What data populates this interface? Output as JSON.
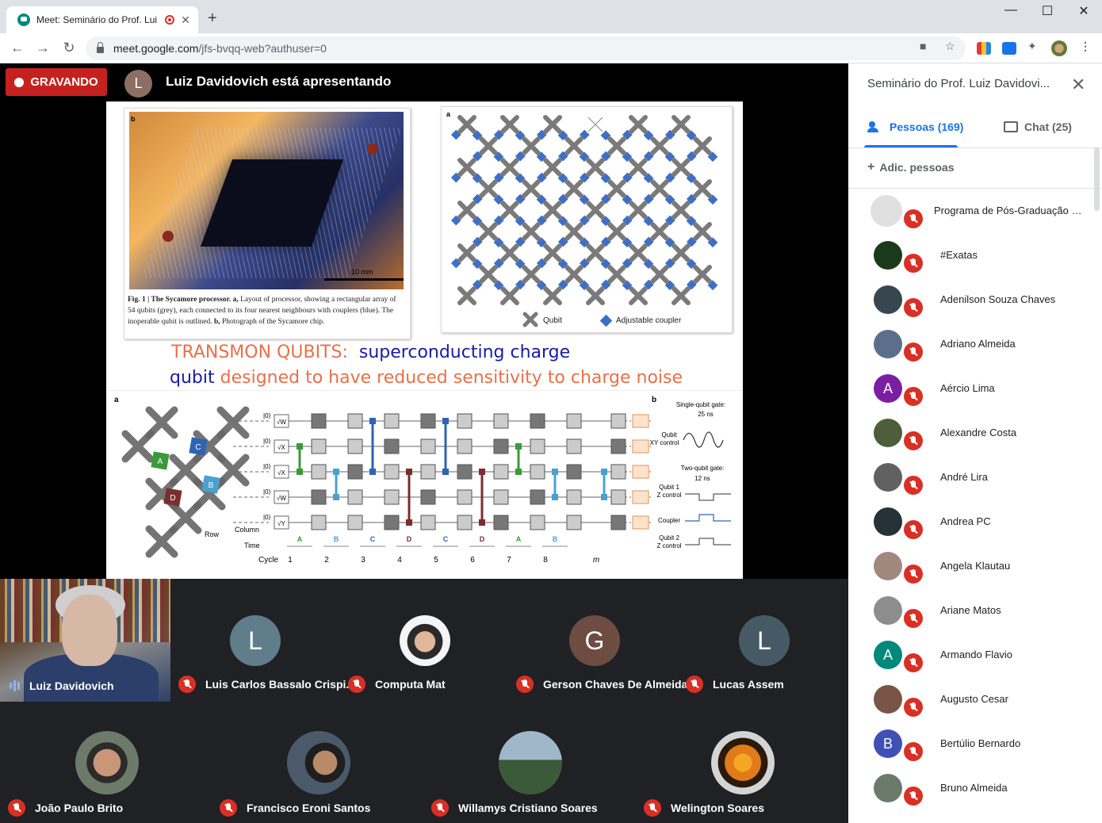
{
  "browser": {
    "tab_title": "Meet: Seminário do Prof. Lui",
    "tab_close": "✕",
    "new_tab": "+",
    "url_host": "meet.google.com",
    "url_path": "/jfs-bvqq-web?authuser=0",
    "window_min": "—",
    "window_max": "☐",
    "window_close": "✕"
  },
  "meet": {
    "recording_label": "GRAVANDO",
    "presenter_initial": "L",
    "presenter_text": "Luiz Davidovich está apresentando"
  },
  "slide": {
    "panel_b_label": "b",
    "scale_label": "10 mm",
    "caption_bold": "Fig. 1 | The Sycamore processor.",
    "caption_a": "a,",
    "caption_rest": " Layout of processor, showing a rectangular array of 54 qubits (grey), each connected to its four nearest neighbours with couplers (blue). The inoperable qubit is outlined.",
    "caption_b": "b,",
    "caption_end": " Photograph of the Sycamore chip.",
    "panel_a_label": "a",
    "legend_qubit": "Qubit",
    "legend_coupler": "Adjustable coupler",
    "title_line1_red": "TRANSMON QUBITS:",
    "title_line1_blue": "superconducting charge",
    "title_line2_blue": "qubit",
    "title_line2_red": "designed to have reduced sensitivity to charge noise",
    "circuit": {
      "label_a": "a",
      "label_b": "b",
      "init_gates": [
        "√W",
        "√X",
        "√X",
        "√W",
        "√Y"
      ],
      "ket": "|0⟩",
      "row_label": "Row",
      "column_label": "Column",
      "time_label": "Time",
      "cycle_label": "Cycle",
      "cycles": [
        "1",
        "2",
        "3",
        "4",
        "5",
        "6",
        "7",
        "8",
        "m"
      ],
      "pattern": [
        "A",
        "B",
        "C",
        "D",
        "C",
        "D",
        "A",
        "B"
      ],
      "node_labels": [
        "A",
        "B",
        "C",
        "D"
      ],
      "single_gate": "Single-qubit gate:",
      "single_ns": "25 ns",
      "qubit_xy": "Qubit",
      "xy_control": "XY control",
      "two_gate": "Two-qubit gate:",
      "two_ns": "12 ns",
      "qubit1": "Qubit 1",
      "z_control": "Z control",
      "coupler": "Coupler",
      "qubit2": "Qubit 2",
      "z_control2": "Z control"
    }
  },
  "tiles": {
    "self_name": "Luiz Davidovich",
    "row1": [
      {
        "name": "Luis Carlos Bassalo Crispi...",
        "initial": "L",
        "color": "#607d8b"
      },
      {
        "name": "Computa Mat",
        "initial": "",
        "color": "#3a3a3a"
      },
      {
        "name": "Gerson Chaves De Almeida",
        "initial": "G",
        "color": "#6d4c41"
      },
      {
        "name": "Lucas Assem",
        "initial": "L",
        "color": "#455a64"
      }
    ],
    "row2": [
      {
        "name": "João Paulo Brito"
      },
      {
        "name": "Francisco Eroni Santos"
      },
      {
        "name": "Willamys Cristiano Soares"
      },
      {
        "name": "Welington Soares"
      }
    ]
  },
  "sidebar": {
    "title": "Seminário do Prof. Luiz Davidovi...",
    "close": "✕",
    "people_tab": "Pessoas (169)",
    "chat_tab": "Chat (25)",
    "add_people": "Adic. pessoas",
    "add_icon": "+",
    "participants": [
      {
        "name": "Programa de Pós-Graduação e...",
        "initial": "",
        "color": "#e0e0e0"
      },
      {
        "name": "#Exatas",
        "initial": "",
        "color": "#1b3a1b"
      },
      {
        "name": "Adenilson Souza Chaves",
        "initial": "",
        "color": "#37474f"
      },
      {
        "name": "Adriano Almeida",
        "initial": "",
        "color": "#5c6f8a"
      },
      {
        "name": "Aércio Lima",
        "initial": "A",
        "color": "#7b1fa2"
      },
      {
        "name": "Alexandre Costa",
        "initial": "",
        "color": "#4e5d3a"
      },
      {
        "name": "André Lira",
        "initial": "",
        "color": "#616161"
      },
      {
        "name": "Andrea PC",
        "initial": "",
        "color": "#263238"
      },
      {
        "name": "Angela Klautau",
        "initial": "",
        "color": "#a1887f"
      },
      {
        "name": "Ariane Matos",
        "initial": "",
        "color": "#8d8d8d"
      },
      {
        "name": "Armando Flavio",
        "initial": "A",
        "color": "#00897b"
      },
      {
        "name": "Augusto Cesar",
        "initial": "",
        "color": "#795548"
      },
      {
        "name": "Bertúlio Bernardo",
        "initial": "B",
        "color": "#3f51b5"
      },
      {
        "name": "Bruno Almeida",
        "initial": "",
        "color": "#6b7b6b"
      }
    ]
  }
}
